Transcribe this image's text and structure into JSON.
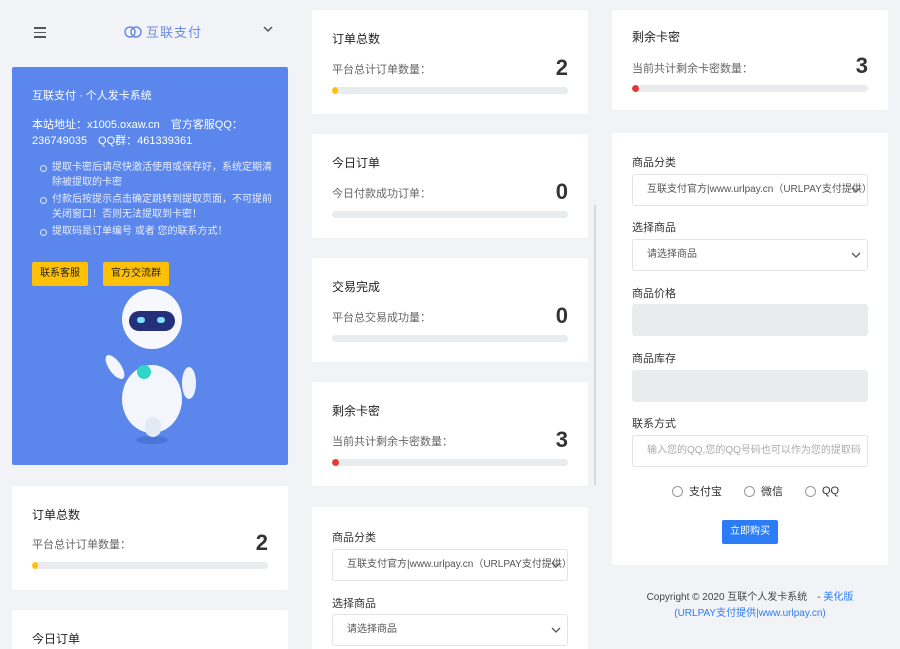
{
  "header": {
    "logo_text": "互联支付"
  },
  "info": {
    "title": "互联支付 · 个人发卡系统",
    "site_line": "本站地址：x1005.oxaw.cn　官方客服QQ：236749035　QQ群：461339361",
    "notes": [
      "提取卡密后请尽快激活使用或保存好，系统定期清除被提取的卡密",
      "付款后按提示点击确定跳转到提取页面，不可提前关闭窗口！否则无法提取到卡密！",
      "提取码是订单编号 或者 您的联系方式！"
    ],
    "btn_service": "联系客服",
    "btn_group": "官方交流群"
  },
  "stats": {
    "orders_total": {
      "title": "订单总数",
      "sub": "平台总计订单数量：",
      "value": "2",
      "progress": 0.02,
      "color": "#ffc107"
    },
    "orders_today": {
      "title": "今日订单",
      "sub": "今日付款成功订单：",
      "value": "0",
      "progress": 0,
      "color": "#2b7cf6"
    },
    "trades_done": {
      "title": "交易完成",
      "sub": "平台总交易成功量：",
      "value": "0",
      "progress": 0,
      "color": "#28a745"
    },
    "cards_left": {
      "title": "剩余卡密",
      "sub": "当前共计剩余卡密数量：",
      "value": "3",
      "progress": 0.03,
      "color": "#e53935"
    }
  },
  "form": {
    "category_label": "商品分类",
    "category_value": "互联支付官方|www.urlpay.cn（URLPAY支付提供）",
    "product_label": "选择商品",
    "product_value": "请选择商品",
    "price_label": "商品价格",
    "stock_label": "商品库存",
    "contact_label": "联系方式",
    "contact_placeholder": "输入您的QQ,您的QQ号码也可以作为您的提取码",
    "pay_options": [
      "支付宝",
      "微信",
      "QQ"
    ],
    "buy_label": "立即购买"
  },
  "footer": {
    "copyright": "Copyright © 2020 互联个人发卡系统　-",
    "link": "美化版",
    "provider": "(URLPAY支付提供|www.urlpay.cn)"
  }
}
